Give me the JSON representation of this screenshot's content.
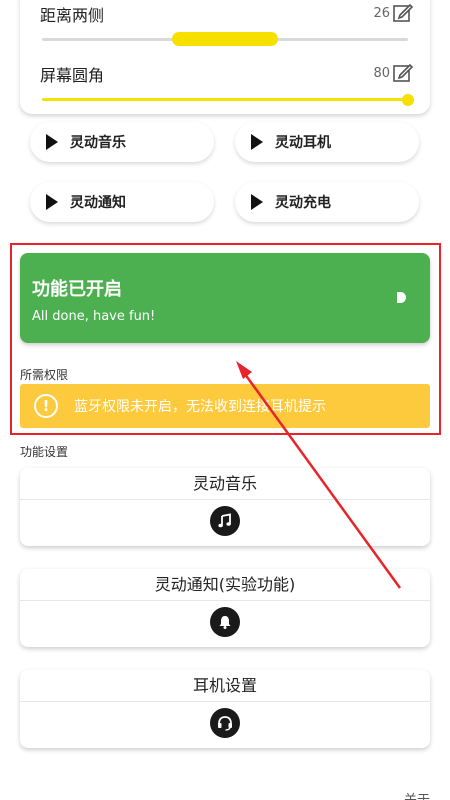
{
  "sliders": [
    {
      "label": "距离两侧",
      "value": "26"
    },
    {
      "label": "屏幕圆角",
      "value": "80"
    }
  ],
  "quick_buttons": [
    "灵动音乐",
    "灵动耳机",
    "灵动通知",
    "灵动充电"
  ],
  "status_card": {
    "title": "功能已开启",
    "subtitle": "All done, have fun!"
  },
  "permissions": {
    "section_title": "所需权限",
    "warning": "蓝牙权限未开启，无法收到连接耳机提示"
  },
  "feature_settings": {
    "section_title": "功能设置",
    "cards": [
      {
        "title": "灵动音乐",
        "icon": "music-note-icon"
      },
      {
        "title": "灵动通知(实验功能)",
        "icon": "bell-icon"
      },
      {
        "title": "耳机设置",
        "icon": "headset-icon"
      }
    ]
  },
  "footer": {
    "about": "关于"
  },
  "colors": {
    "accent_yellow": "#f5e000",
    "success_green": "#4caf50",
    "warning_yellow": "#fdc93d",
    "annotation_red": "#e8242b"
  }
}
